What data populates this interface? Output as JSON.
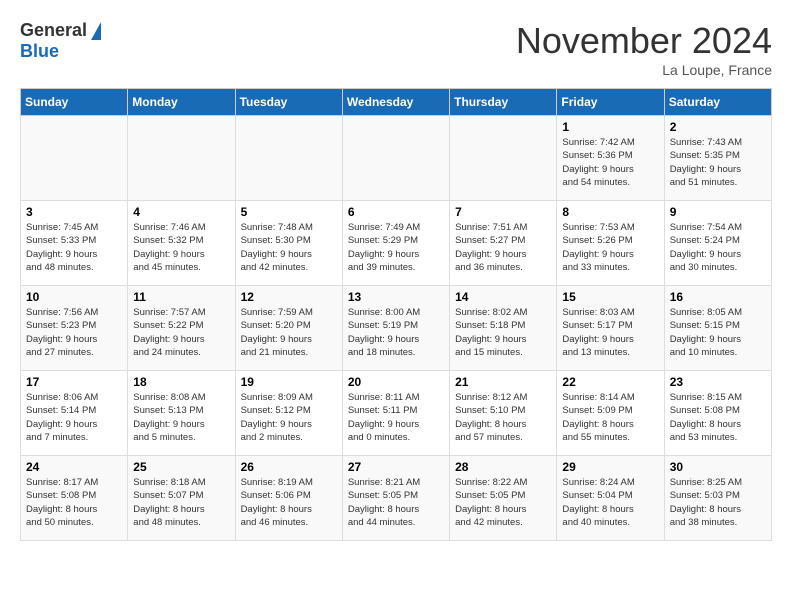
{
  "header": {
    "logo_general": "General",
    "logo_blue": "Blue",
    "title": "November 2024",
    "location": "La Loupe, France"
  },
  "weekdays": [
    "Sunday",
    "Monday",
    "Tuesday",
    "Wednesday",
    "Thursday",
    "Friday",
    "Saturday"
  ],
  "weeks": [
    [
      {
        "day": "",
        "info": ""
      },
      {
        "day": "",
        "info": ""
      },
      {
        "day": "",
        "info": ""
      },
      {
        "day": "",
        "info": ""
      },
      {
        "day": "",
        "info": ""
      },
      {
        "day": "1",
        "info": "Sunrise: 7:42 AM\nSunset: 5:36 PM\nDaylight: 9 hours\nand 54 minutes."
      },
      {
        "day": "2",
        "info": "Sunrise: 7:43 AM\nSunset: 5:35 PM\nDaylight: 9 hours\nand 51 minutes."
      }
    ],
    [
      {
        "day": "3",
        "info": "Sunrise: 7:45 AM\nSunset: 5:33 PM\nDaylight: 9 hours\nand 48 minutes."
      },
      {
        "day": "4",
        "info": "Sunrise: 7:46 AM\nSunset: 5:32 PM\nDaylight: 9 hours\nand 45 minutes."
      },
      {
        "day": "5",
        "info": "Sunrise: 7:48 AM\nSunset: 5:30 PM\nDaylight: 9 hours\nand 42 minutes."
      },
      {
        "day": "6",
        "info": "Sunrise: 7:49 AM\nSunset: 5:29 PM\nDaylight: 9 hours\nand 39 minutes."
      },
      {
        "day": "7",
        "info": "Sunrise: 7:51 AM\nSunset: 5:27 PM\nDaylight: 9 hours\nand 36 minutes."
      },
      {
        "day": "8",
        "info": "Sunrise: 7:53 AM\nSunset: 5:26 PM\nDaylight: 9 hours\nand 33 minutes."
      },
      {
        "day": "9",
        "info": "Sunrise: 7:54 AM\nSunset: 5:24 PM\nDaylight: 9 hours\nand 30 minutes."
      }
    ],
    [
      {
        "day": "10",
        "info": "Sunrise: 7:56 AM\nSunset: 5:23 PM\nDaylight: 9 hours\nand 27 minutes."
      },
      {
        "day": "11",
        "info": "Sunrise: 7:57 AM\nSunset: 5:22 PM\nDaylight: 9 hours\nand 24 minutes."
      },
      {
        "day": "12",
        "info": "Sunrise: 7:59 AM\nSunset: 5:20 PM\nDaylight: 9 hours\nand 21 minutes."
      },
      {
        "day": "13",
        "info": "Sunrise: 8:00 AM\nSunset: 5:19 PM\nDaylight: 9 hours\nand 18 minutes."
      },
      {
        "day": "14",
        "info": "Sunrise: 8:02 AM\nSunset: 5:18 PM\nDaylight: 9 hours\nand 15 minutes."
      },
      {
        "day": "15",
        "info": "Sunrise: 8:03 AM\nSunset: 5:17 PM\nDaylight: 9 hours\nand 13 minutes."
      },
      {
        "day": "16",
        "info": "Sunrise: 8:05 AM\nSunset: 5:15 PM\nDaylight: 9 hours\nand 10 minutes."
      }
    ],
    [
      {
        "day": "17",
        "info": "Sunrise: 8:06 AM\nSunset: 5:14 PM\nDaylight: 9 hours\nand 7 minutes."
      },
      {
        "day": "18",
        "info": "Sunrise: 8:08 AM\nSunset: 5:13 PM\nDaylight: 9 hours\nand 5 minutes."
      },
      {
        "day": "19",
        "info": "Sunrise: 8:09 AM\nSunset: 5:12 PM\nDaylight: 9 hours\nand 2 minutes."
      },
      {
        "day": "20",
        "info": "Sunrise: 8:11 AM\nSunset: 5:11 PM\nDaylight: 9 hours\nand 0 minutes."
      },
      {
        "day": "21",
        "info": "Sunrise: 8:12 AM\nSunset: 5:10 PM\nDaylight: 8 hours\nand 57 minutes."
      },
      {
        "day": "22",
        "info": "Sunrise: 8:14 AM\nSunset: 5:09 PM\nDaylight: 8 hours\nand 55 minutes."
      },
      {
        "day": "23",
        "info": "Sunrise: 8:15 AM\nSunset: 5:08 PM\nDaylight: 8 hours\nand 53 minutes."
      }
    ],
    [
      {
        "day": "24",
        "info": "Sunrise: 8:17 AM\nSunset: 5:08 PM\nDaylight: 8 hours\nand 50 minutes."
      },
      {
        "day": "25",
        "info": "Sunrise: 8:18 AM\nSunset: 5:07 PM\nDaylight: 8 hours\nand 48 minutes."
      },
      {
        "day": "26",
        "info": "Sunrise: 8:19 AM\nSunset: 5:06 PM\nDaylight: 8 hours\nand 46 minutes."
      },
      {
        "day": "27",
        "info": "Sunrise: 8:21 AM\nSunset: 5:05 PM\nDaylight: 8 hours\nand 44 minutes."
      },
      {
        "day": "28",
        "info": "Sunrise: 8:22 AM\nSunset: 5:05 PM\nDaylight: 8 hours\nand 42 minutes."
      },
      {
        "day": "29",
        "info": "Sunrise: 8:24 AM\nSunset: 5:04 PM\nDaylight: 8 hours\nand 40 minutes."
      },
      {
        "day": "30",
        "info": "Sunrise: 8:25 AM\nSunset: 5:03 PM\nDaylight: 8 hours\nand 38 minutes."
      }
    ]
  ]
}
